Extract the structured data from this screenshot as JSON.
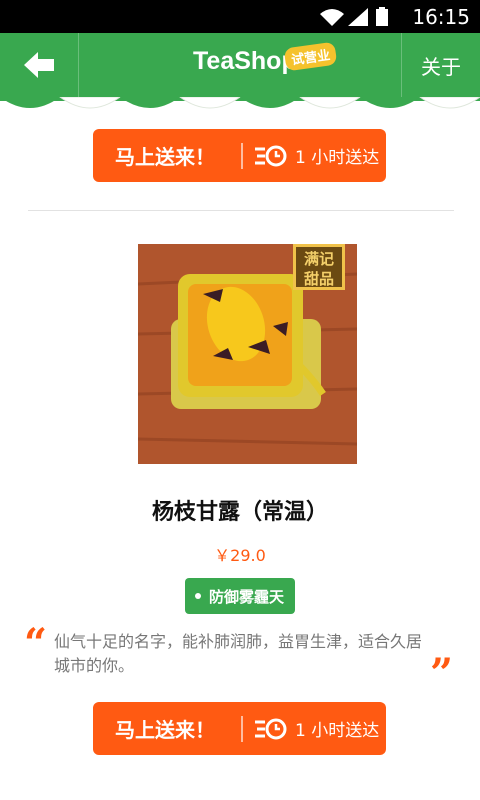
{
  "statusbar": {
    "time": "16:15"
  },
  "header": {
    "brand": "TeaShop",
    "badge": "试营业",
    "about": "关于"
  },
  "cta_top": {
    "label": "马上送来！",
    "delivery": "1 小时送达"
  },
  "product": {
    "stamp_line1": "满记",
    "stamp_line2": "甜品",
    "name": "杨枝甘露（常温）",
    "price": "￥29.0",
    "tag": "防御雾霾天",
    "description": "仙气十足的名字，能补肺润肺，益胃生津，适合久居城市的你。"
  },
  "cta_bottom": {
    "label": "马上送来！",
    "delivery": "1 小时送达"
  },
  "colors": {
    "green": "#39a84f",
    "orange": "#ff5a12",
    "badge": "#f5c22d"
  },
  "icons": [
    "wifi-icon",
    "signal-icon",
    "battery-icon",
    "back-arrow-icon",
    "delivery-clock-icon"
  ]
}
